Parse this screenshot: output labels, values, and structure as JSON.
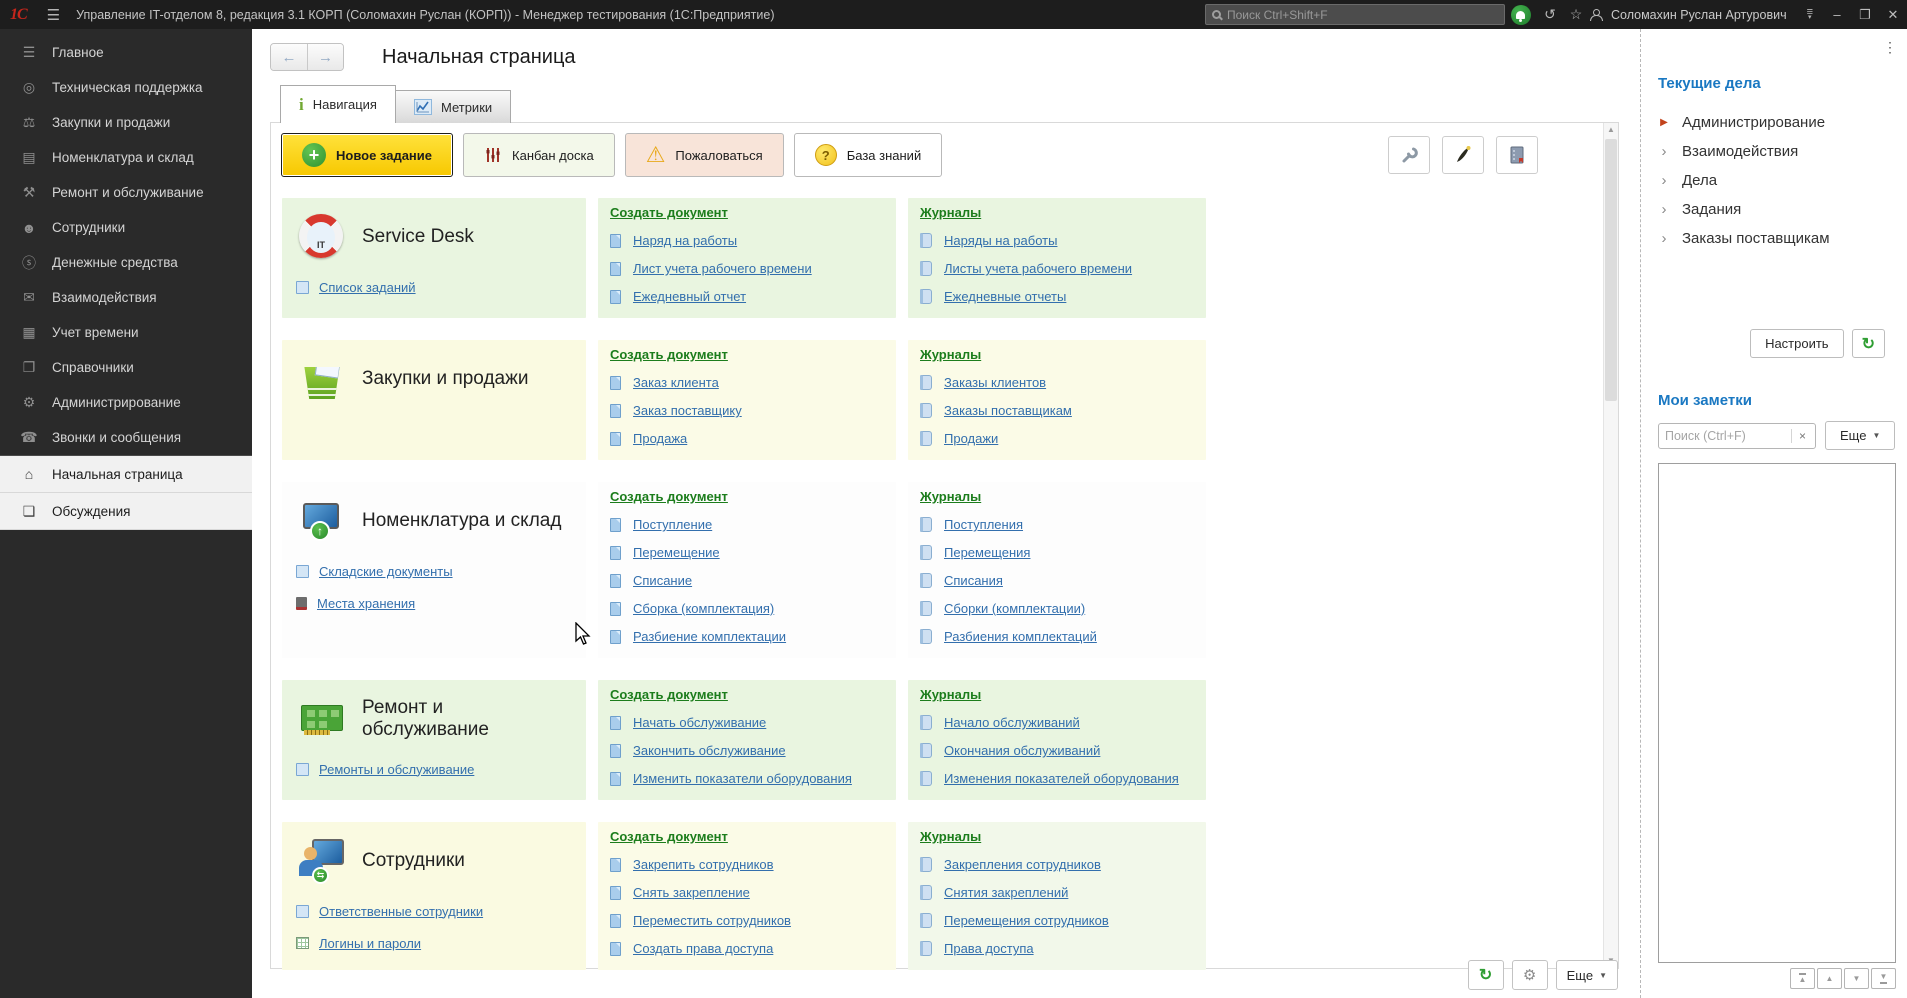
{
  "titlebar": {
    "app_title": "Управление IT-отделом 8, редакция 3.1 КОРП (Соломахин Руслан (КОРП))  - Менеджер тестирования (1С:Предприятие)",
    "search_placeholder": "Поиск Ctrl+Shift+F",
    "user_name": "Соломахин Руслан Артурович"
  },
  "sidebar": {
    "items": [
      {
        "id": "main",
        "label": "Главное",
        "icon": "main-menu-icon",
        "glyph": "☰"
      },
      {
        "id": "tech-support",
        "label": "Техническая поддержка",
        "icon": "lifebuoy-icon",
        "glyph": "◎"
      },
      {
        "id": "purchases-sales",
        "label": "Закупки и продажи",
        "icon": "truck-icon",
        "glyph": "⚖"
      },
      {
        "id": "nomenclature-warehouse",
        "label": "Номенклатура и склад",
        "icon": "printer-icon",
        "glyph": "▤"
      },
      {
        "id": "repair-service",
        "label": "Ремонт и обслуживание",
        "icon": "tools-icon",
        "glyph": "⚒"
      },
      {
        "id": "employees",
        "label": "Сотрудники",
        "icon": "people-icon",
        "glyph": "☻"
      },
      {
        "id": "money",
        "label": "Денежные средства",
        "icon": "money-bag-icon",
        "glyph": "ⓢ"
      },
      {
        "id": "interactions",
        "label": "Взаимодействия",
        "icon": "mail-icon",
        "glyph": "✉"
      },
      {
        "id": "time-tracking",
        "label": "Учет времени",
        "icon": "calendar-icon",
        "glyph": "▦"
      },
      {
        "id": "references",
        "label": "Справочники",
        "icon": "books-icon",
        "glyph": "❐"
      },
      {
        "id": "administration",
        "label": "Администрирование",
        "icon": "gear-icon",
        "glyph": "⚙"
      },
      {
        "id": "calls-messages",
        "label": "Звонки и сообщения",
        "icon": "phone-icon",
        "glyph": "☎"
      }
    ],
    "pinned": [
      {
        "id": "start-page",
        "label": "Начальная страница",
        "icon": "home-icon",
        "glyph": "⌂"
      },
      {
        "id": "discussions",
        "label": "Обсуждения",
        "icon": "chat-icon",
        "glyph": "❏"
      }
    ]
  },
  "main": {
    "title": "Начальная страница",
    "tabs": [
      {
        "label": "Навигация",
        "icon": "info-icon",
        "active": true
      },
      {
        "label": "Метрики",
        "icon": "chart-icon",
        "active": false
      }
    ],
    "toolbar": {
      "new_task": "Новое задание",
      "kanban": "Канбан доска",
      "complain": "Пожаловаться",
      "knowledge_base": "База знаний"
    },
    "sections": [
      {
        "id": "service-desk",
        "title": "Service Desk",
        "icon": "service-desk-icon",
        "colors": {
          "left": "#e9f5e0",
          "create": "#e9f5e0",
          "journals": "#e9f5e0"
        },
        "left_links": [
          {
            "label": "Список заданий",
            "icon": "tasks-list-icon",
            "kind": "sq"
          }
        ],
        "create_header": "Создать документ",
        "create_links": [
          "Наряд на работы",
          "Лист учета рабочего времени",
          "Ежедневный отчет"
        ],
        "journals_header": "Журналы",
        "journal_links": [
          "Наряды на работы",
          "Листы учета рабочего времени",
          "Ежедневные отчеты"
        ]
      },
      {
        "id": "purchases-sales",
        "title": "Закупки и продажи",
        "icon": "basket-icon",
        "colors": {
          "left": "#fafae1",
          "create": "#fbfbe7",
          "journals": "#fbfbe7"
        },
        "left_links": [],
        "create_header": "Создать документ",
        "create_links": [
          "Заказ клиента",
          "Заказ поставщику",
          "Продажа"
        ],
        "journals_header": "Журналы",
        "journal_links": [
          "Заказы клиентов",
          "Заказы поставщикам",
          "Продажи"
        ]
      },
      {
        "id": "nomenclature-warehouse",
        "title": "Номенклатура и склад",
        "icon": "monitor-arrow-icon",
        "colors": {
          "left": "#fdfdfd",
          "create": "#fdfdfd",
          "journals": "#fdfdfd"
        },
        "left_links": [
          {
            "label": "Складские документы",
            "icon": "warehouse-docs-icon",
            "kind": "sq"
          },
          {
            "label": "Места хранения",
            "icon": "storage-places-icon",
            "kind": "book"
          }
        ],
        "create_header": "Создать документ",
        "create_links": [
          "Поступление",
          "Перемещение",
          "Списание",
          "Сборка (комплектация)",
          "Разбиение комплектации"
        ],
        "journals_header": "Журналы",
        "journal_links": [
          "Поступления",
          "Перемещения",
          "Списания",
          "Сборки (комплектации)",
          "Разбиения комплектаций"
        ]
      },
      {
        "id": "repair-service",
        "title": "Ремонт и обслуживание",
        "icon": "circuit-board-icon",
        "colors": {
          "left": "#e9f5e0",
          "create": "#e9f5e0",
          "journals": "#e9f5e0"
        },
        "left_links": [
          {
            "label": "Ремонты и обслуживание",
            "icon": "repairs-icon",
            "kind": "sq"
          }
        ],
        "create_header": "Создать документ",
        "create_links": [
          "Начать обслуживание",
          "Закончить обслуживание",
          "Изменить показатели оборудования"
        ],
        "journals_header": "Журналы",
        "journal_links": [
          "Начало обслуживаний",
          "Окончания обслуживаний",
          "Изменения показателей оборудования"
        ]
      },
      {
        "id": "employees",
        "title": "Сотрудники",
        "icon": "employee-icon",
        "colors": {
          "left": "#fafae1",
          "create": "#fbfbe7",
          "journals": "#f2f8ea"
        },
        "left_links": [
          {
            "label": "Ответственные сотрудники",
            "icon": "responsible-employees-icon",
            "kind": "sq"
          },
          {
            "label": "Логины и пароли",
            "icon": "logins-passwords-icon",
            "kind": "grid"
          }
        ],
        "create_header": "Создать документ",
        "create_links": [
          "Закрепить сотрудников",
          "Снять закрепление",
          "Переместить сотрудников",
          "Создать права доступа"
        ],
        "journals_header": "Журналы",
        "journal_links": [
          "Закрепления сотрудников",
          "Снятия закреплений",
          "Перемещения сотрудников",
          "Права доступа"
        ]
      }
    ],
    "footer": {
      "more": "Еще"
    }
  },
  "right_panel": {
    "todo": {
      "title": "Текущие дела",
      "items": [
        {
          "label": "Администрирование",
          "expanded": true
        },
        {
          "label": "Взаимодействия",
          "expanded": false
        },
        {
          "label": "Дела",
          "expanded": false
        },
        {
          "label": "Задания",
          "expanded": false
        },
        {
          "label": "Заказы поставщикам",
          "expanded": false
        }
      ],
      "configure": "Настроить"
    },
    "notes": {
      "title": "Мои заметки",
      "search_placeholder": "Поиск (Ctrl+F)",
      "more": "Еще"
    }
  },
  "colors": {
    "titlebar_bg": "#1d1d1d",
    "sidebar_bg": "#2a2a2a",
    "accent_new_task": "#f7c800",
    "complain_bg": "#f8e4d9",
    "kanban_bg": "#f3f8ea",
    "link_blue": "#336fad",
    "header_green": "#1c7d1c",
    "panel_heading_blue": "#1a78c2",
    "notification_green": "#2a8a2d",
    "expanded_arrow_red": "#c2431c"
  }
}
